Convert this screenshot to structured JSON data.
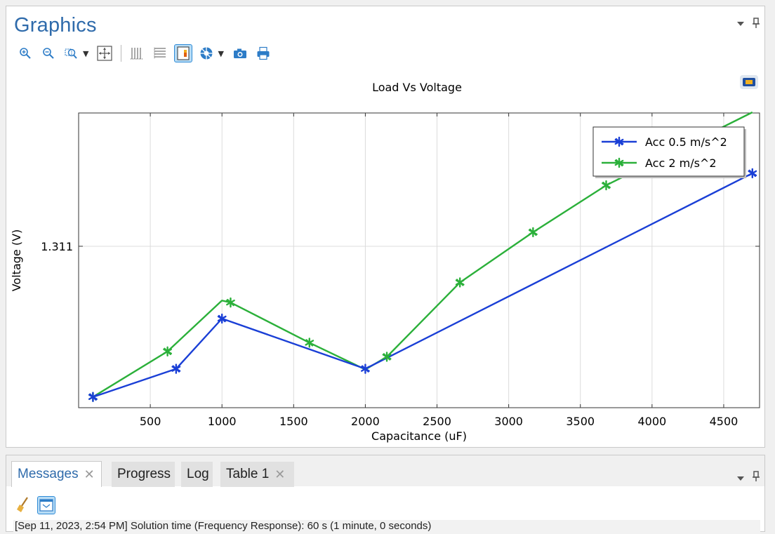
{
  "graphics": {
    "title": "Graphics"
  },
  "toolbar": {
    "icons": [
      "zoom-in-icon",
      "zoom-out-icon",
      "zoom-box-icon",
      "zoom-extents-icon",
      "grid-lines-icon",
      "table-rows-icon",
      "legend-toggle-icon",
      "color-wheel-icon",
      "camera-icon",
      "print-icon"
    ]
  },
  "messages": {
    "tabs": [
      {
        "label": "Messages",
        "active": true
      },
      {
        "label": "Progress",
        "active": false
      },
      {
        "label": "Log",
        "active": false
      },
      {
        "label": "Table 1",
        "active": false
      }
    ],
    "line": "[Sep 11, 2023, 2:54 PM] Solution time (Frequency Response): 60 s (1 minute, 0 seconds)"
  },
  "colors": {
    "accent": "#2f6bab",
    "series1": "#1a3fd6",
    "series2": "#2bb03a"
  },
  "chart_data": {
    "type": "line",
    "title": "Load Vs Voltage",
    "xlabel": "Capacitance (uF)",
    "ylabel": "Voltage (V)",
    "xlim": [
      0,
      4750
    ],
    "xticks": [
      500,
      1000,
      1500,
      2000,
      2500,
      3000,
      3500,
      4000,
      4500
    ],
    "yticks": [
      1.311
    ],
    "ylim": [
      1.2869,
      1.3309
    ],
    "grid": true,
    "legend_position": "top-right",
    "series": [
      {
        "name": "Acc 0.5 m/s^2",
        "color": "#1a3fd6",
        "marker": "asterisk",
        "x": [
          100,
          680,
          1000,
          2000,
          4700
        ],
        "y": [
          1.2885,
          1.2927,
          1.3002,
          1.2927,
          1.3219
        ]
      },
      {
        "name": "Acc 2 m/s^2",
        "color": "#2bb03a",
        "marker": "asterisk",
        "x": [
          100,
          620,
          1000,
          1060,
          1610,
          2000,
          2150,
          2660,
          3170,
          3680,
          4700
        ],
        "x_markers": [
          100,
          620,
          1060,
          1610,
          2150,
          2660,
          3170,
          3680
        ],
        "y": [
          1.2885,
          1.2953,
          1.3029,
          1.3026,
          1.2966,
          1.2926,
          1.2945,
          1.3056,
          1.3131,
          1.3201,
          1.331
        ]
      }
    ]
  }
}
